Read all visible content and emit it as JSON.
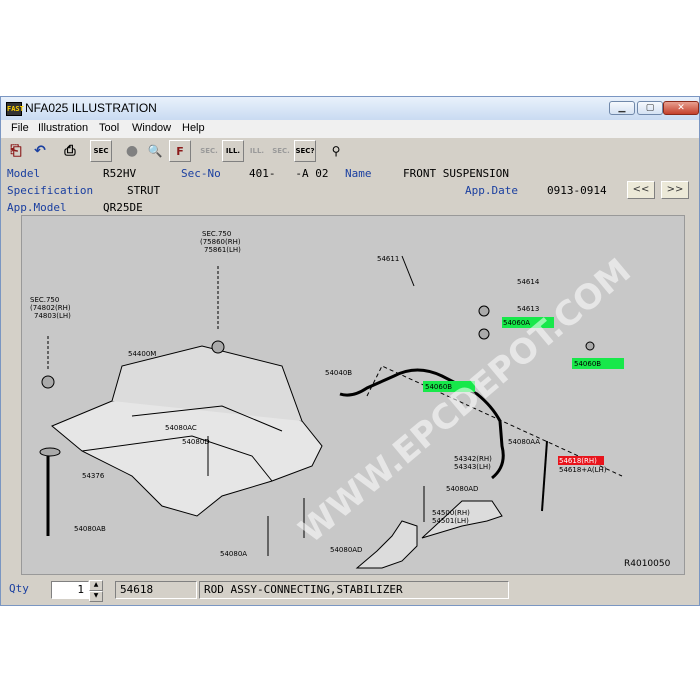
{
  "window": {
    "title": "NFA025 ILLUSTRATION",
    "icon_label": "FAST",
    "controls": {
      "minimize": "▁",
      "maximize": "▢",
      "close": "✕"
    }
  },
  "menu": [
    "File",
    "Illustration",
    "Tool",
    "Window",
    "Help"
  ],
  "toolbar": {
    "buttons": [
      {
        "name": "exit-icon",
        "glyph": "⎗"
      },
      {
        "name": "undo-icon",
        "glyph": "↶"
      },
      {
        "name": "print-icon",
        "glyph": "⎙"
      },
      {
        "name": "sec-icon",
        "glyph": "SEC"
      },
      {
        "name": "circle-icon",
        "glyph": "●"
      },
      {
        "name": "magnifier-icon",
        "glyph": "🔍"
      },
      {
        "name": "notebook-icon",
        "glyph": "F"
      },
      {
        "name": "sec-prev-icon",
        "glyph": "SEC."
      },
      {
        "name": "ill-icon",
        "glyph": "ILL."
      },
      {
        "name": "ill-next-icon",
        "glyph": "ILL."
      },
      {
        "name": "sec-next-icon",
        "glyph": "SEC."
      },
      {
        "name": "sec-query-icon",
        "glyph": "SEC?"
      },
      {
        "name": "pin-icon",
        "glyph": "⚲"
      }
    ]
  },
  "info": {
    "model_label": "Model",
    "model_value": "R52HV",
    "secno_label": "Sec-No",
    "secno_value": "401-   -A 02",
    "name_label": "Name",
    "name_value": "FRONT SUSPENSION",
    "spec_label": "Specification",
    "spec_value": "STRUT",
    "appdate_label": "App.Date",
    "appdate_value": "0913-0914",
    "appmodel_label": "App.Model",
    "appmodel_value": "QR25DE",
    "prev_label": "<<",
    "next_label": ">>"
  },
  "illustration": {
    "figure_id": "R4010050",
    "watermark": "WWW.EPCDEPOT.COM",
    "highlight_colors": {
      "green": "#17e84a",
      "red": "#e8141c"
    },
    "callouts": [
      {
        "text": "SEC.750",
        "sub": [
          "(74802(RH)",
          "74803(LH)"
        ]
      },
      {
        "text": "SEC.750",
        "sub": [
          "(75860(RH)",
          "75861(LH)"
        ]
      },
      {
        "text": "54611"
      },
      {
        "text": "54060A",
        "hl": "green"
      },
      {
        "text": "54614"
      },
      {
        "text": "54613"
      },
      {
        "text": "54060B",
        "hl": "green"
      },
      {
        "text": "54060B",
        "hl": "green"
      },
      {
        "text": "54400M"
      },
      {
        "text": "54040B"
      },
      {
        "text": "54080AC"
      },
      {
        "text": "54080D"
      },
      {
        "text": "54376"
      },
      {
        "text": "54080AB"
      },
      {
        "text": "54080AA"
      },
      {
        "text": "54342(RH)"
      },
      {
        "text": "54343(LH)"
      },
      {
        "text": "54618(RH)",
        "hl": "red"
      },
      {
        "text": "54618+A(LH)"
      },
      {
        "text": "54080AD"
      },
      {
        "text": "54500(RH)"
      },
      {
        "text": "54501(LH)"
      },
      {
        "text": "54080A"
      },
      {
        "text": "54080AD"
      }
    ]
  },
  "bottom": {
    "qty_label": "Qty",
    "qty_value": "1",
    "part_number": "54618",
    "part_name": "ROD ASSY-CONNECTING,STABILIZER"
  }
}
